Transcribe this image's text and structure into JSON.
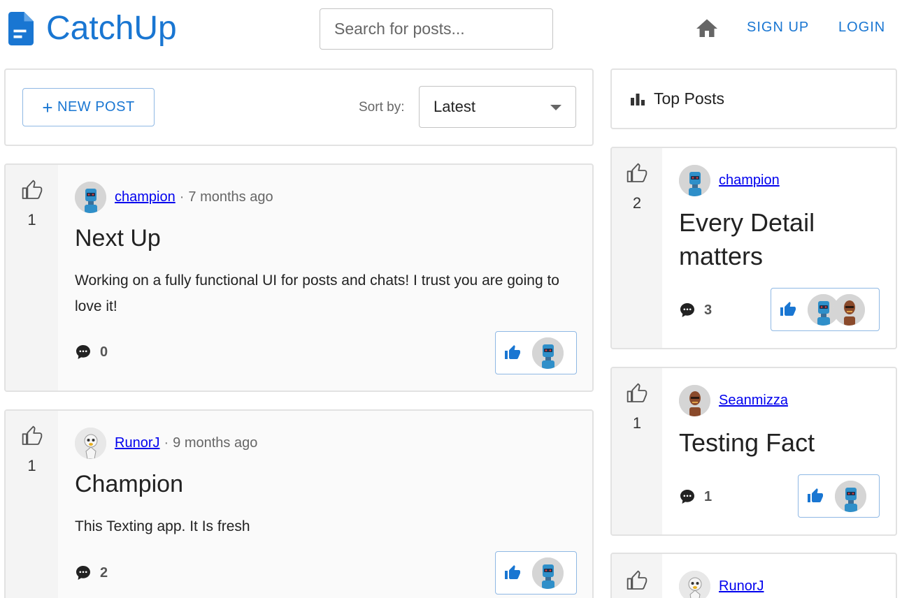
{
  "app": {
    "name": "CatchUp"
  },
  "search": {
    "placeholder": "Search for posts..."
  },
  "nav": {
    "signup": "SIGN UP",
    "login": "LOGIN"
  },
  "toolbar": {
    "new_post": "NEW POST",
    "sort_label": "Sort by:",
    "sort_value": "Latest"
  },
  "feed": [
    {
      "likes": "1",
      "author": "champion",
      "separator": "·",
      "time": "7 months ago",
      "title": "Next Up",
      "body": "Working on a fully functional UI for posts and chats! I trust you are going to love it!",
      "comments": "0"
    },
    {
      "likes": "1",
      "author": "RunorJ",
      "separator": "·",
      "time": "9 months ago",
      "title": "Champion",
      "body": "This Texting app. It Is fresh",
      "comments": "2"
    }
  ],
  "sidebar": {
    "header": "Top Posts",
    "posts": [
      {
        "likes": "2",
        "author": "champion",
        "title": "Every Detail matters",
        "comments": "3"
      },
      {
        "likes": "1",
        "author": "Seanmizza",
        "title": "Testing Fact",
        "comments": "1"
      },
      {
        "likes": "",
        "author": "RunorJ",
        "title": "",
        "comments": ""
      }
    ]
  },
  "colors": {
    "brand": "#1976d2",
    "link": "#0000ee",
    "vote_bg": "#f4f4f4"
  }
}
